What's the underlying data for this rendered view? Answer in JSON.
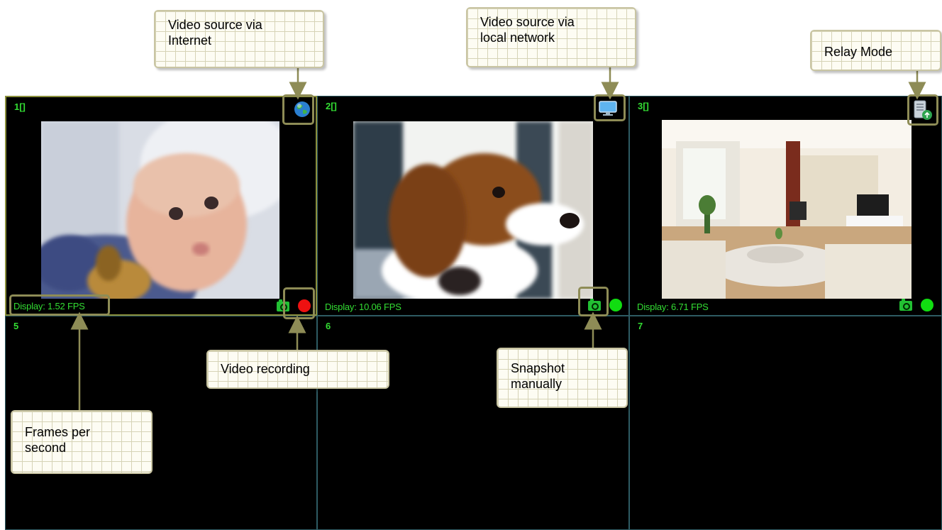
{
  "cameras": [
    {
      "label": "1[]",
      "fps": "Display: 1.52 FPS",
      "source_icon": "globe-icon",
      "status_color": "#ee1111",
      "selected": true
    },
    {
      "label": "2[]",
      "fps": "Display: 10.06 FPS",
      "source_icon": "monitor-icon",
      "status_color": "#11dd11"
    },
    {
      "label": "3[]",
      "fps": "Display: 6.71 FPS",
      "source_icon": "relay-server-icon",
      "status_color": "#11dd11"
    },
    {
      "label": "5"
    },
    {
      "label": "6"
    },
    {
      "label": "7"
    }
  ],
  "callouts": {
    "internet": "Video source via\nInternet",
    "local": "Video source via\nlocal network",
    "relay": "Relay Mode",
    "recording": "Video recording",
    "snapshot": "Snapshot\nmanually",
    "fps": "Frames per\nsecond"
  },
  "colors": {
    "label_green": "#33dd33",
    "grid_line": "#2e5b63",
    "callout_border": "#c9c5a3",
    "highlight_border": "#8e8c56"
  }
}
